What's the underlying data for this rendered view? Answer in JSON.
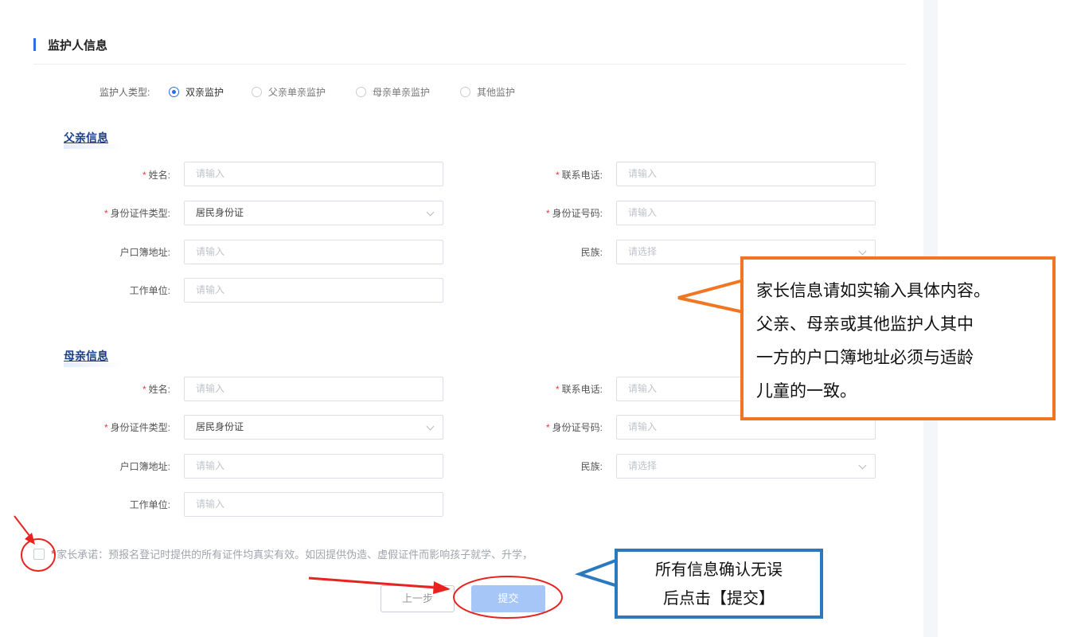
{
  "section": {
    "title": "监护人信息"
  },
  "guardian_type": {
    "label": "监护人类型:",
    "options": [
      "双亲监护",
      "父亲单亲监护",
      "母亲单亲监护",
      "其他监护"
    ],
    "selected": "双亲监护"
  },
  "father": {
    "title": "父亲信息",
    "name_label": "姓名:",
    "name_placeholder": "请输入",
    "phone_label": "联系电话:",
    "phone_placeholder": "请输入",
    "idtype_label": "身份证件类型:",
    "idtype_value": "居民身份证",
    "idno_label": "身份证号码:",
    "idno_placeholder": "请输入",
    "address_label": "户口簿地址:",
    "address_placeholder": "请输入",
    "ethnic_label": "民族:",
    "ethnic_placeholder": "请选择",
    "work_label": "工作单位:",
    "work_placeholder": "请输入"
  },
  "mother": {
    "title": "母亲信息",
    "name_label": "姓名:",
    "name_placeholder": "请输入",
    "phone_label": "联系电话:",
    "phone_placeholder": "请输入",
    "idtype_label": "身份证件类型:",
    "idtype_value": "居民身份证",
    "idno_label": "身份证号码:",
    "idno_placeholder": "请输入",
    "address_label": "户口簿地址:",
    "address_placeholder": "请输入",
    "ethnic_label": "民族:",
    "ethnic_placeholder": "请选择",
    "work_label": "工作单位:",
    "work_placeholder": "请输入"
  },
  "required_mark": "*",
  "promise": {
    "text": "家长承诺：预报名登记时提供的所有证件均真实有效。如因提供伪造、虚假证件而影响孩子就学、升学，"
  },
  "buttons": {
    "prev": "上一步",
    "submit": "提交"
  },
  "annotations": {
    "orange_lines": [
      "家长信息请如实输入具体内容。",
      "父亲、母亲或其他监护人其中",
      "一方的户口簿地址必须与适龄",
      "儿童的一致。"
    ],
    "blue_lines": [
      "所有信息确认无误",
      "后点击【提交】"
    ]
  },
  "colors": {
    "accent": "#2b6fe6",
    "required": "#e53c3c",
    "callout_orange": "#f07622",
    "callout_blue": "#2b7ac0",
    "arrow_red": "#e8231f"
  }
}
